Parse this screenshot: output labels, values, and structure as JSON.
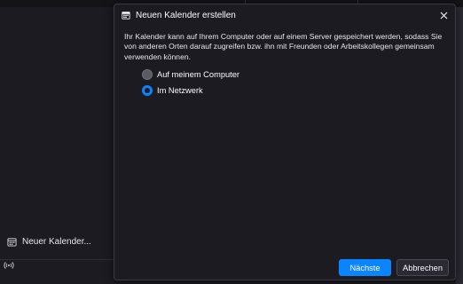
{
  "colors": {
    "background": "#1c1b22",
    "accent": "#0a84ff",
    "text": "#fbfbfe",
    "dialog_border": "#3a3944"
  },
  "sidebar": {
    "new_calendar_label": "Neuer Kalender...",
    "new_calendar_icon": "calendar-icon",
    "status_icon": "broadcast-icon"
  },
  "dialog": {
    "title": "Neuen Kalender erstellen",
    "title_icon": "calendar-icon",
    "close_icon": "close-icon",
    "description": "Ihr Kalender kann auf Ihrem Computer oder auf einem Server gespeichert werden, sodass Sie von anderen Orten darauf zugreifen bzw. ihn mit Freunden oder Arbeitskollegen gemeinsam verwenden können.",
    "options": [
      {
        "label": "Auf meinem Computer",
        "selected": false
      },
      {
        "label": "Im Netzwerk",
        "selected": true
      }
    ],
    "next_button": "Nächste",
    "cancel_button": "Abbrechen"
  }
}
